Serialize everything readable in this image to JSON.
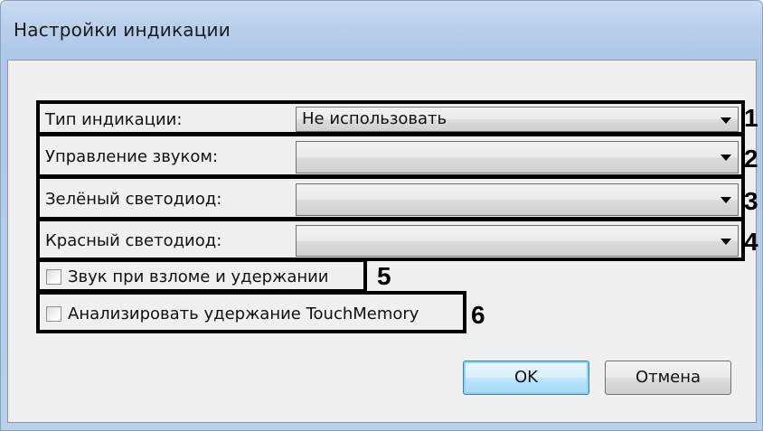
{
  "window": {
    "title": "Настройки индикации"
  },
  "fields": [
    {
      "label": "Тип индикации:",
      "value": "Не использовать",
      "marker": "1"
    },
    {
      "label": "Управление звуком:",
      "value": "",
      "marker": "2"
    },
    {
      "label": "Зелёный светодиод:",
      "value": "",
      "marker": "3"
    },
    {
      "label": "Красный светодиод:",
      "value": "",
      "marker": "4"
    }
  ],
  "checkboxes": [
    {
      "label": "Звук при взломе и удержании",
      "checked": false,
      "marker": "5"
    },
    {
      "label": "Анализировать удержание TouchMemory",
      "checked": false,
      "marker": "6"
    }
  ],
  "buttons": {
    "ok": "OK",
    "cancel": "Отмена"
  },
  "icons": {
    "dropdown": "chevron-down-icon",
    "checkbox": "checkbox-unchecked-icon"
  },
  "colors": {
    "annotation_border": "#000000",
    "title_bar": "#b9d0ec",
    "client_bg": "#f0f0f0",
    "default_button_glow": "#8fd3f5"
  }
}
